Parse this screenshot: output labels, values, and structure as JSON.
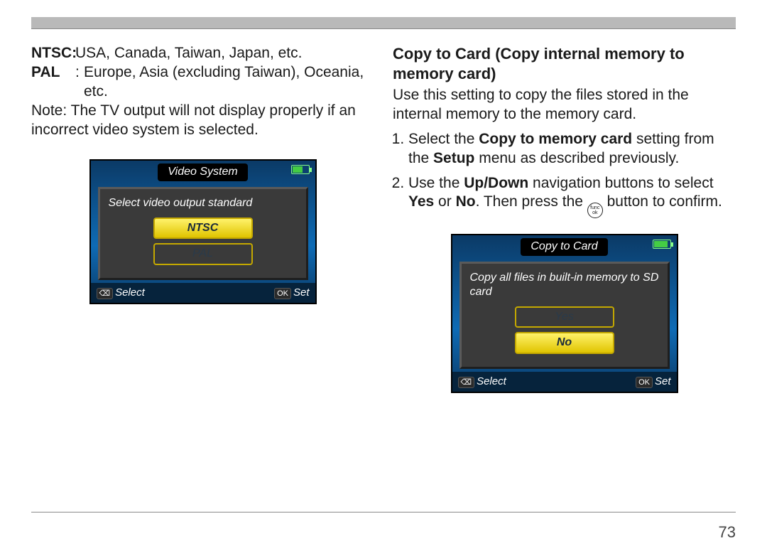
{
  "page_number": "73",
  "left": {
    "ntsc_label": "NTSC:",
    "ntsc_regions": "USA, Canada, Taiwan, Japan, etc.",
    "pal_label": "PAL",
    "pal_colon": ":",
    "pal_regions": "Europe, Asia (excluding Taiwan), Oceania, etc.",
    "note": "Note: The TV output will not display properly if an incorrect video system is selected.",
    "lcd": {
      "title": "Video System",
      "message": "Select video output standard",
      "options": [
        "NTSC",
        "PAL"
      ],
      "selected_index": 0,
      "footer_left_key": "⌫",
      "footer_left": "Select",
      "footer_right_key": "OK",
      "footer_right": "Set"
    }
  },
  "right": {
    "heading": "Copy to Card (Copy internal memory to memory card)",
    "intro": "Use this setting to copy the files stored in the internal memory to the memory card.",
    "step1_pre": "Select the ",
    "step1_bold": "Copy to memory card",
    "step1_post_a": " setting from the ",
    "step1_bold2": "Setup",
    "step1_post_b": " menu as described previously.",
    "step2_pre": "Use the ",
    "step2_bold": "Up/Down",
    "step2_mid": " navigation buttons to select ",
    "step2_yes": "Yes",
    "step2_or": " or ",
    "step2_no": "No",
    "step2_then": ". Then press the ",
    "step2_end": " button to confirm.",
    "func_top": "func",
    "func_bot": "ok",
    "lcd": {
      "title": "Copy to Card",
      "message": "Copy all files in built-in memory to SD card",
      "options": [
        "Yes",
        "No"
      ],
      "selected_index": 1,
      "footer_left_key": "⌫",
      "footer_left": "Select",
      "footer_right_key": "OK",
      "footer_right": "Set"
    }
  }
}
